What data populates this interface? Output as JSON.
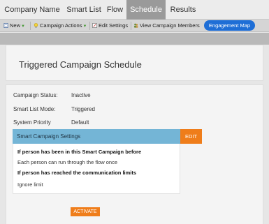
{
  "tabs": [
    {
      "label": "Company Name"
    },
    {
      "label": "Smart List"
    },
    {
      "label": "Flow"
    },
    {
      "label": "Schedule",
      "active": true
    },
    {
      "label": "Results"
    }
  ],
  "toolbar": {
    "new_label": "New",
    "campaign_actions_label": "Campaign Actions",
    "edit_settings_label": "Edit Settings",
    "view_members_label": "View Campaign Members",
    "engagement_map_label": "Engagement Map"
  },
  "header": {
    "title": "Triggered Campaign Schedule"
  },
  "info": {
    "campaign_status_label": "Campaign Status:",
    "campaign_status_value": "Inactive",
    "smart_list_mode_label": "Smart List Mode:",
    "smart_list_mode_value": "Triggered",
    "system_priority_label": "System Priority",
    "system_priority_value": "Default"
  },
  "settings": {
    "title": "Smart Campaign Settings",
    "edit_label": "EDIT",
    "line1": "If person has been in this Smart Campaign before",
    "line2": "Each person can run through the flow once",
    "line3": "If person has reached the communication limits",
    "line4": "Ignore limit"
  },
  "activate_label": "ACTIVATE",
  "colors": {
    "accent_blue": "#1e6ed6",
    "settings_header": "#74b5d6",
    "orange": "#ef7d1a",
    "active_tab": "#9a9a9a"
  },
  "icons": {
    "new": "document-icon",
    "campaign_actions": "lightbulb-icon",
    "edit_settings": "edit-settings-icon",
    "view_members": "people-icon"
  }
}
